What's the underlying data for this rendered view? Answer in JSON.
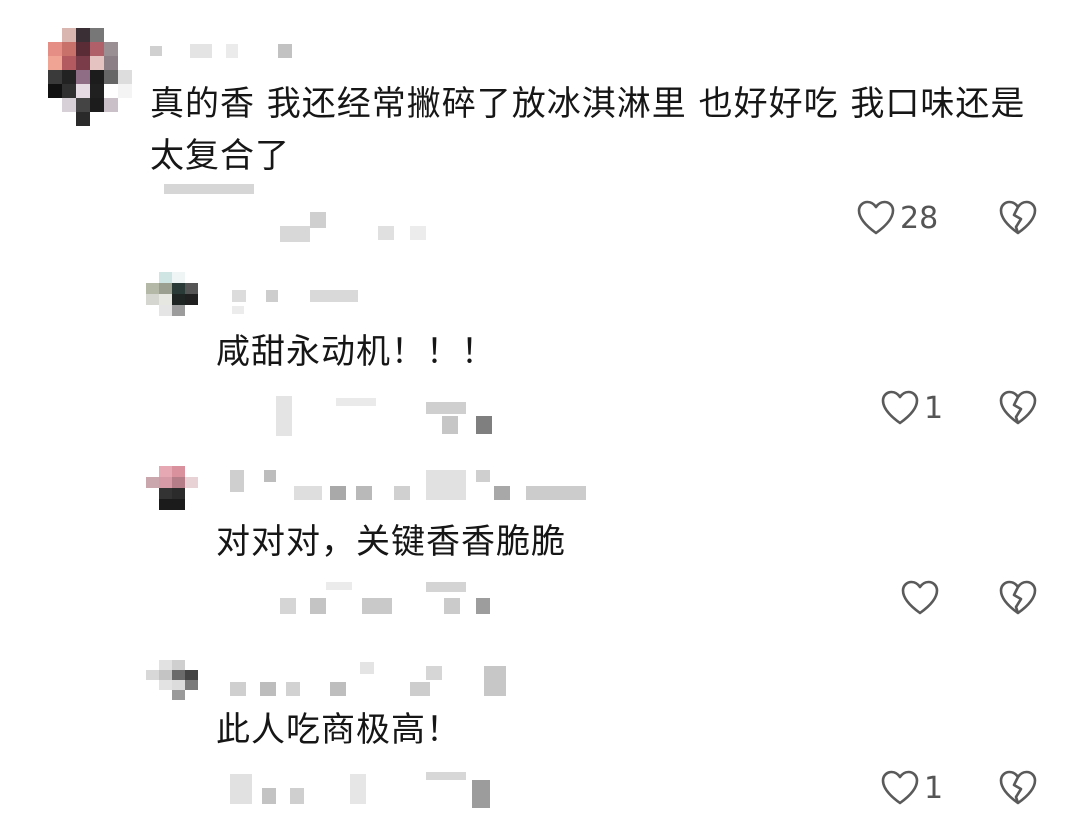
{
  "comments": [
    {
      "text": "真的香 我还经常撇碎了放冰淇淋里 也好好吃 我口味还是\n太复合了",
      "like_count": "28"
    },
    {
      "text": "咸甜永动机！！！",
      "like_count": "1"
    },
    {
      "text": "对对对，关键香香脆脆",
      "like_count": ""
    },
    {
      "text": "此人吃商极高！",
      "like_count": "1"
    }
  ],
  "icons": {
    "like": "heart-outline-icon",
    "dislike": "broken-heart-icon"
  },
  "colors": {
    "text": "#161616",
    "icon": "#5a5a5a",
    "mosaic_light": "#e6e6e6",
    "mosaic_mid": "#bdbdbd"
  }
}
